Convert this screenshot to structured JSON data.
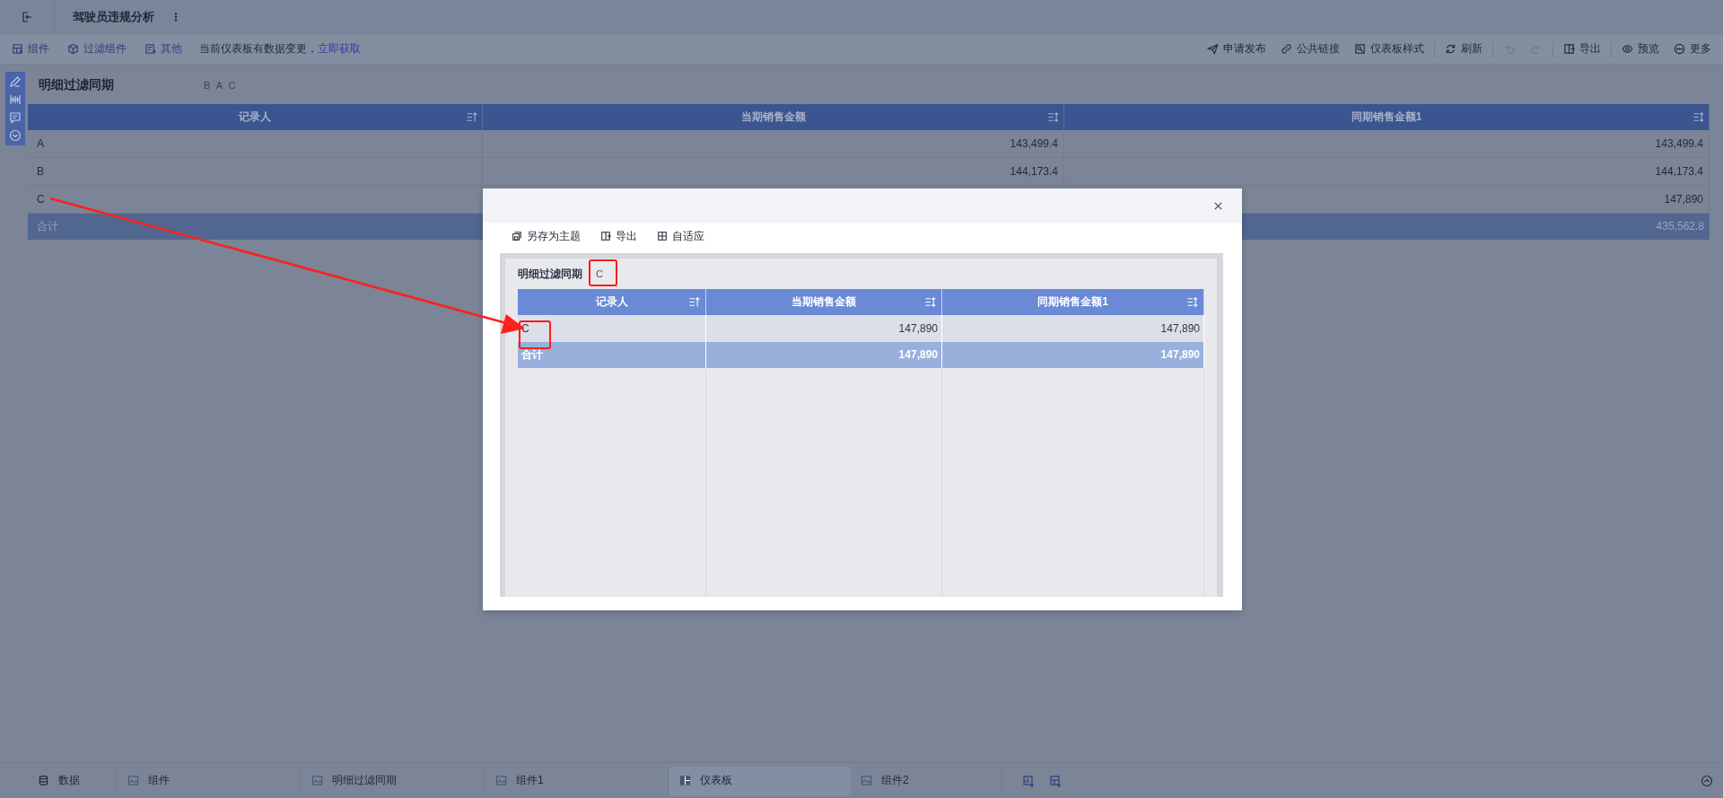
{
  "topbar": {
    "title": "驾驶员违规分析"
  },
  "toolbar": {
    "left": [
      {
        "label": "组件"
      },
      {
        "label": "过滤组件"
      },
      {
        "label": "其他"
      }
    ],
    "notice": "当前仪表板有数据变更，",
    "notice_link": "立即获取",
    "right": [
      {
        "kind": "button",
        "label": "申请发布",
        "disabled": false
      },
      {
        "kind": "button",
        "label": "公共链接",
        "disabled": false
      },
      {
        "kind": "button",
        "label": "仪表板样式",
        "disabled": false
      },
      {
        "kind": "separator"
      },
      {
        "kind": "button",
        "label": "刷新",
        "disabled": false
      },
      {
        "kind": "separator"
      },
      {
        "kind": "icon",
        "disabled": true
      },
      {
        "kind": "icon",
        "disabled": true
      },
      {
        "kind": "separator"
      },
      {
        "kind": "button",
        "label": "导出",
        "disabled": false
      },
      {
        "kind": "separator"
      },
      {
        "kind": "button",
        "label": "预览",
        "disabled": false
      },
      {
        "kind": "button",
        "label": "更多",
        "disabled": false
      }
    ]
  },
  "widget": {
    "title": "明细过滤同期",
    "filter_text": "B A C",
    "columns": [
      {
        "label": "记录人",
        "sorted": true
      },
      {
        "label": "当期销售金额",
        "sorted": false
      },
      {
        "label": "同期销售金额1",
        "sorted": false
      }
    ],
    "rows": [
      {
        "recorder": "A",
        "current": "143,499.4",
        "same_period": "143,499.4"
      },
      {
        "recorder": "B",
        "current": "144,173.4",
        "same_period": "144,173.4"
      },
      {
        "recorder": "C",
        "same_period": "147,890"
      }
    ],
    "total": {
      "recorder": "合计",
      "same_period": "435,562.8"
    }
  },
  "dialog": {
    "toolbar": [
      {
        "label": "另存为主题"
      },
      {
        "label": "导出"
      },
      {
        "label": "自适应"
      }
    ],
    "widget": {
      "title": "明细过滤同期",
      "filter_text": "C",
      "columns": [
        {
          "label": "记录人",
          "sorted": true
        },
        {
          "label": "当期销售金额",
          "sorted": false
        },
        {
          "label": "同期销售金额1",
          "sorted": false
        }
      ],
      "rows": [
        {
          "recorder": "C",
          "current": "147,890",
          "same_period": "147,890"
        }
      ],
      "total": {
        "recorder": "合计",
        "current": "147,890",
        "same_period": "147,890"
      }
    }
  },
  "bottom_tabs": [
    {
      "label": "数据",
      "selected": false
    },
    {
      "label": "组件",
      "selected": false
    },
    {
      "label": "明细过滤同期",
      "selected": false
    },
    {
      "label": "组件1",
      "selected": false
    },
    {
      "label": "仪表板",
      "selected": true
    },
    {
      "label": "组件2",
      "selected": false
    }
  ]
}
